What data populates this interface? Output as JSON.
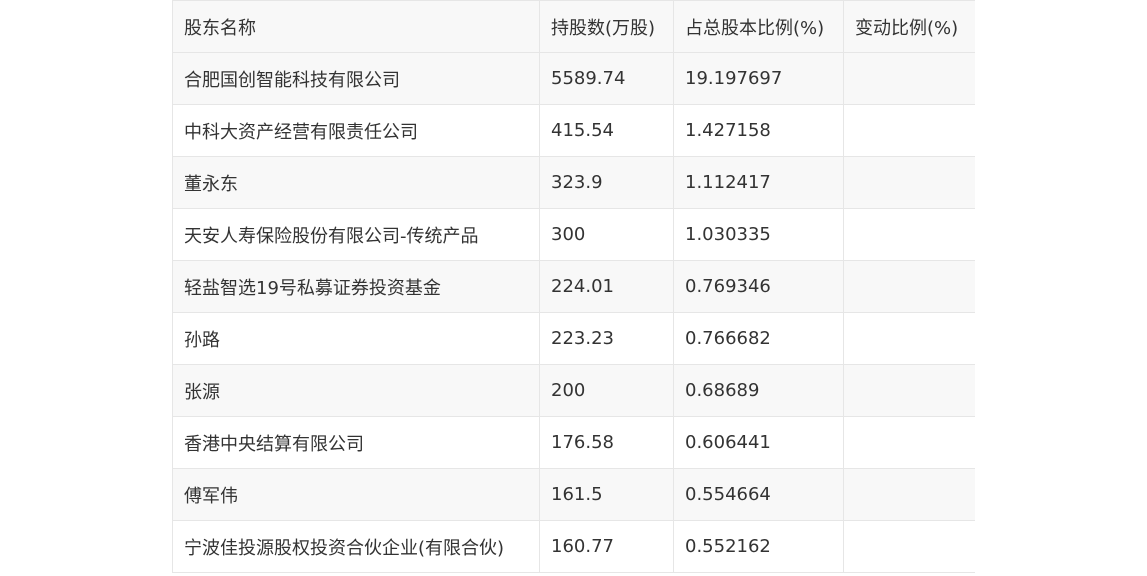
{
  "table": {
    "headers": [
      "股东名称",
      "持股数(万股)",
      "占总股本比例(%)",
      "变动比例(%)"
    ],
    "rows": [
      [
        "合肥国创智能科技有限公司",
        "5589.74",
        "19.197697",
        ""
      ],
      [
        "中科大资产经营有限责任公司",
        "415.54",
        "1.427158",
        ""
      ],
      [
        "董永东",
        "323.9",
        "1.112417",
        ""
      ],
      [
        "天安人寿保险股份有限公司-传统产品",
        "300",
        "1.030335",
        ""
      ],
      [
        "轻盐智选19号私募证券投资基金",
        "224.01",
        "0.769346",
        ""
      ],
      [
        "孙路",
        "223.23",
        "0.766682",
        ""
      ],
      [
        "张源",
        "200",
        "0.68689",
        ""
      ],
      [
        "香港中央结算有限公司",
        "176.58",
        "0.606441",
        ""
      ],
      [
        "傅军伟",
        "161.5",
        "0.554664",
        ""
      ],
      [
        "宁波佳投源股权投资合伙企业(有限合伙)",
        "160.77",
        "0.552162",
        ""
      ]
    ]
  }
}
